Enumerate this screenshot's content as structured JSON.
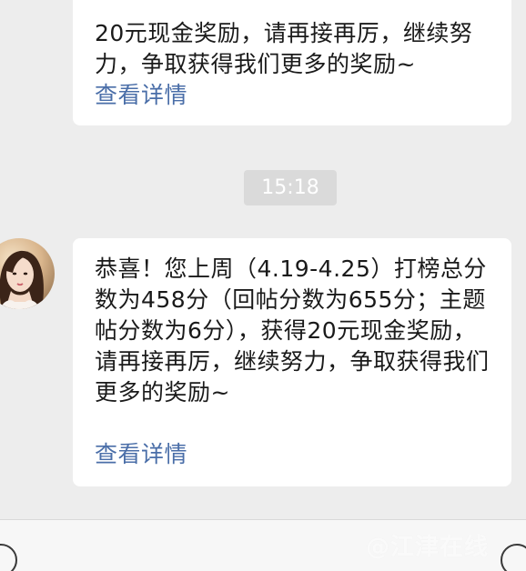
{
  "messages": [
    {
      "text": "20元现金奖励，请再接再厉，继续努力，争取获得我们更多的奖励~",
      "link": "查看详情"
    },
    {
      "text": "恭喜！您上周（4.19-4.25）打榜总分数为458分（回帖分数为655分；主题帖分数为6分），获得20元现金奖励，请再接再厉，继续努力，争取获得我们更多的奖励~",
      "link": "查看详情"
    }
  ],
  "timestamp": "15:18",
  "watermark": "@江津在线",
  "icons": {
    "avatar": "user-avatar",
    "voice": "voice-icon",
    "emoji": "emoji-icon"
  },
  "colors": {
    "background": "#ededed",
    "bubble": "#ffffff",
    "link": "#4a6ea8",
    "timestamp_bg": "#dadada"
  }
}
